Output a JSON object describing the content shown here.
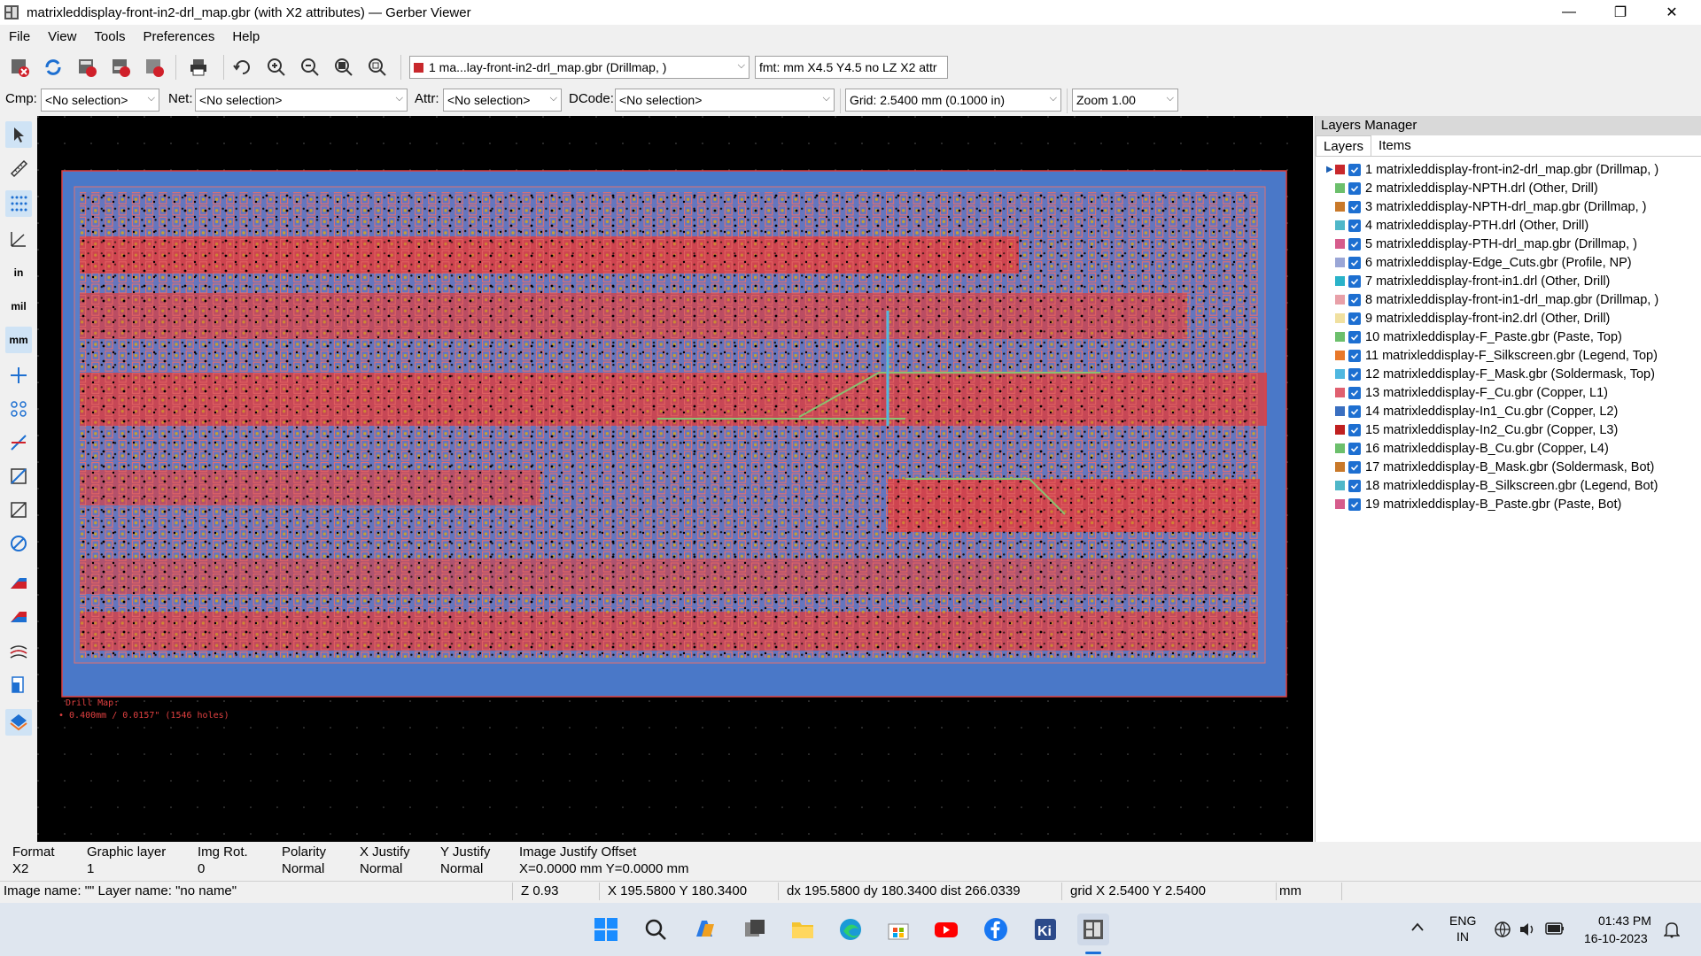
{
  "window": {
    "title": "matrixleddisplay-front-in2-drl_map.gbr (with X2 attributes) — Gerber Viewer",
    "min": "—",
    "max": "❐",
    "close": "✕"
  },
  "menu": [
    "File",
    "View",
    "Tools",
    "Preferences",
    "Help"
  ],
  "toolbar": {
    "layer_select": "1 ma...lay-front-in2-drl_map.gbr (Drillmap, )",
    "fmt": "fmt: mm X4.5 Y4.5 no LZ X2 attr"
  },
  "filters": {
    "cmp_label": "Cmp:",
    "cmp_value": "<No selection>",
    "net_label": "Net:",
    "net_value": "<No selection>",
    "attr_label": "Attr:",
    "attr_value": "<No selection>",
    "dcode_label": "DCode:",
    "dcode_value": "<No selection>",
    "grid_value": "Grid: 2.5400 mm (0.1000 in)",
    "zoom_value": "Zoom 1.00"
  },
  "canvas": {
    "legend_title": "Drill Map:",
    "legend_line": "• 0.400mm / 0.0157\" (1546 holes)"
  },
  "layers_manager": {
    "title": "Layers Manager",
    "tabs": [
      "Layers",
      "Items"
    ],
    "layers": [
      {
        "label": "1 matrixleddisplay-front-in2-drl_map.gbr (Drillmap, )",
        "color": "#c8282c"
      },
      {
        "label": "2 matrixleddisplay-NPTH.drl (Other, Drill)",
        "color": "#6cbf6c"
      },
      {
        "label": "3 matrixleddisplay-NPTH-drl_map.gbr (Drillmap, )",
        "color": "#c9792a"
      },
      {
        "label": "4 matrixleddisplay-PTH.drl (Other, Drill)",
        "color": "#4fb7c9"
      },
      {
        "label": "5 matrixleddisplay-PTH-drl_map.gbr (Drillmap, )",
        "color": "#d65c8c"
      },
      {
        "label": "6 matrixleddisplay-Edge_Cuts.gbr (Profile, NP)",
        "color": "#9aa6d6"
      },
      {
        "label": "7 matrixleddisplay-front-in1.drl (Other, Drill)",
        "color": "#2ab3c9"
      },
      {
        "label": "8 matrixleddisplay-front-in1-drl_map.gbr (Drillmap, )",
        "color": "#e8a0a8"
      },
      {
        "label": "9 matrixleddisplay-front-in2.drl (Other, Drill)",
        "color": "#f0e0a0"
      },
      {
        "label": "10 matrixleddisplay-F_Paste.gbr (Paste, Top)",
        "color": "#6cbf6c"
      },
      {
        "label": "11 matrixleddisplay-F_Silkscreen.gbr (Legend, Top)",
        "color": "#e8782a"
      },
      {
        "label": "12 matrixleddisplay-F_Mask.gbr (Soldermask, Top)",
        "color": "#4fb7e0"
      },
      {
        "label": "13 matrixleddisplay-F_Cu.gbr (Copper, L1)",
        "color": "#e06070"
      },
      {
        "label": "14 matrixleddisplay-In1_Cu.gbr (Copper, L2)",
        "color": "#3a6fc0"
      },
      {
        "label": "15 matrixleddisplay-In2_Cu.gbr (Copper, L3)",
        "color": "#c02020"
      },
      {
        "label": "16 matrixleddisplay-B_Cu.gbr (Copper, L4)",
        "color": "#6cbf6c"
      },
      {
        "label": "17 matrixleddisplay-B_Mask.gbr (Soldermask, Bot)",
        "color": "#c9792a"
      },
      {
        "label": "18 matrixleddisplay-B_Silkscreen.gbr (Legend, Bot)",
        "color": "#4fb7c9"
      },
      {
        "label": "19 matrixleddisplay-B_Paste.gbr (Paste, Bot)",
        "color": "#d65c8c"
      }
    ]
  },
  "info": {
    "headers": [
      "Format",
      "Graphic layer",
      "Img Rot.",
      "Polarity",
      "X Justify",
      "Y Justify",
      "Image Justify Offset"
    ],
    "values": [
      "X2",
      "1",
      "0",
      "Normal",
      "Normal",
      "Normal",
      "X=0.0000 mm Y=0.0000 mm"
    ]
  },
  "status": {
    "image_name": "Image name: \"\"  Layer name: \"no name\"",
    "zoom": "Z 0.93",
    "xy": "X 195.5800  Y 180.3400",
    "delta": "dx 195.5800  dy 180.3400  dist 266.0339",
    "grid": "grid X 2.5400  Y 2.5400",
    "units": "mm"
  },
  "tray": {
    "lang1": "ENG",
    "lang2": "IN",
    "time": "01:43 PM",
    "date": "16-10-2023"
  },
  "colors": {
    "board": "#4a78c8",
    "copper": "#e03c3c",
    "canvas_bg": "#000000",
    "accent": "#1d6fd1"
  }
}
